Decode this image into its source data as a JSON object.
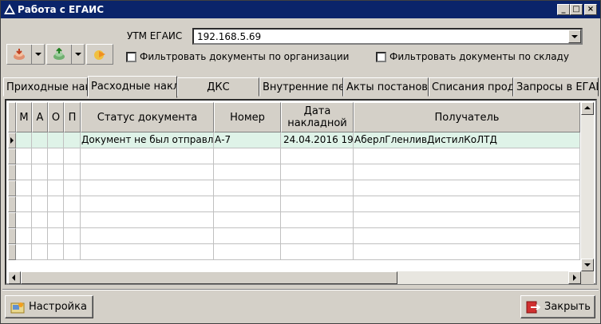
{
  "window": {
    "title": "Работа с ЕГАИС",
    "controls": [
      "minimize-icon",
      "maximize-icon",
      "close-icon"
    ]
  },
  "toolbar": {
    "buttons": [
      "load-icon",
      "upload-icon",
      "forward-icon"
    ]
  },
  "utm": {
    "label": "УТМ ЕГАИС",
    "value": "192.168.5.69"
  },
  "filters": {
    "by_org": {
      "label": "Фильтровать документы по организации",
      "checked": false
    },
    "by_warehouse": {
      "label": "Фильтровать документы по складу",
      "checked": false
    }
  },
  "tabs": [
    "Приходные накладные",
    "Расходные накладные",
    "ДКС",
    "Внутренние перемещения",
    "Акты постановки",
    "Списания продукции",
    "Запросы в ЕГАИС"
  ],
  "active_tab": 1,
  "table": {
    "headers": {
      "m": "М",
      "a": "А",
      "o": "О",
      "p": "П",
      "status": "Статус документа",
      "number": "Номер",
      "date": "Дата накладной",
      "recipient": "Получатель"
    },
    "rows": [
      {
        "status": "Документ не был отправлен",
        "number": "А-7",
        "date": "24.04.2016 19",
        "recipient": "АберлГленливДистилКоЛТД"
      }
    ]
  },
  "buttons": {
    "settings": "Настройка",
    "close": "Закрыть"
  },
  "colors": {
    "titlebar": "#0a246a",
    "selected_row": "#dff3e8"
  }
}
